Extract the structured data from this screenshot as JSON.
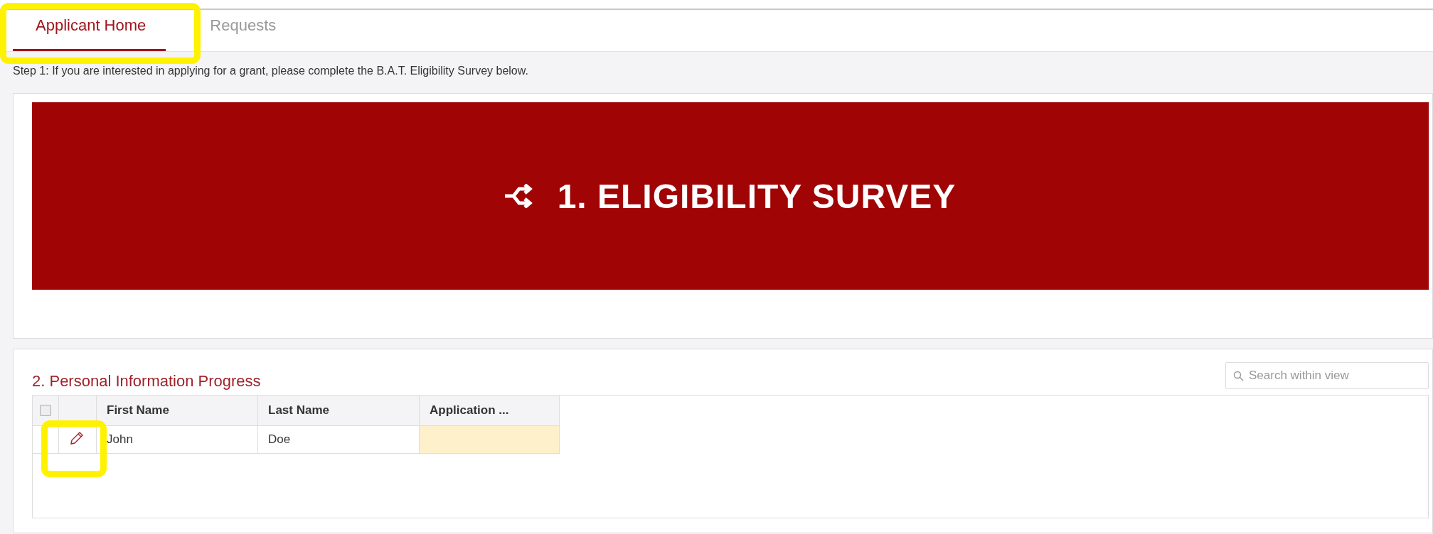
{
  "tabs": [
    {
      "label": "Applicant Home",
      "selected": true
    },
    {
      "label": "Requests",
      "selected": false
    }
  ],
  "instruction": "Step 1: If you are interested in applying for a grant, please complete the B.A.T. Eligibility Survey below.",
  "survey_banner": {
    "title": "1. ELIGIBILITY SURVEY"
  },
  "progress": {
    "heading": "2. Personal Information Progress",
    "search": {
      "placeholder": "Search within view"
    },
    "table": {
      "select_all_checked": false,
      "columns": [
        "First Name",
        "Last Name",
        "Application ..."
      ],
      "rows": [
        {
          "cells": [
            {
              "text": "John",
              "highlighted": false
            },
            {
              "text": "Doe",
              "highlighted": false
            },
            {
              "text": "",
              "highlighted": true
            }
          ]
        }
      ]
    }
  }
}
